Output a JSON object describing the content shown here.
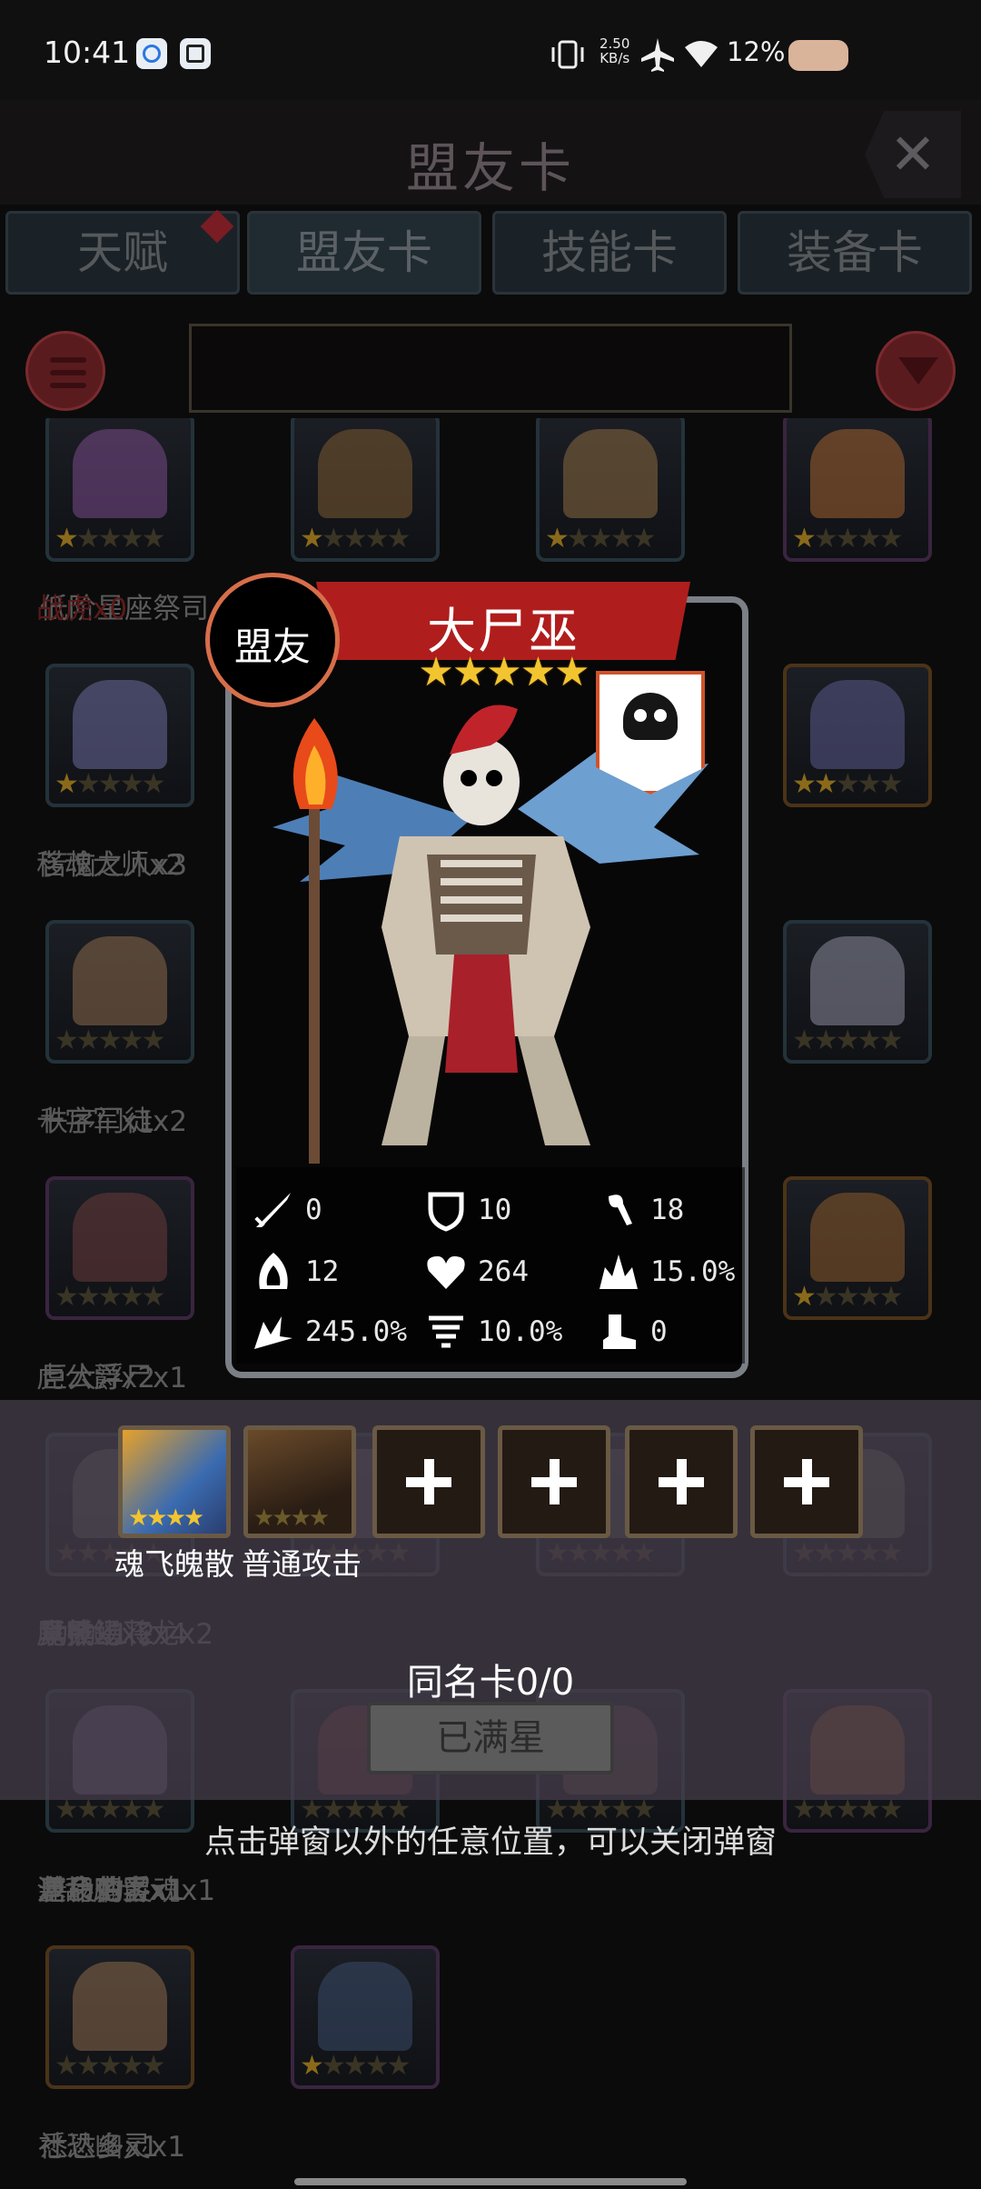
{
  "status_bar": {
    "time": "10:41",
    "net_speed_value": "2.50",
    "net_speed_unit": "KB/s",
    "battery": "12%"
  },
  "header": {
    "title": "盟友卡",
    "close": "✕"
  },
  "tabs": [
    {
      "label": "天赋",
      "has_dot": true
    },
    {
      "label": "盟友卡",
      "active": true
    },
    {
      "label": "技能卡"
    },
    {
      "label": "装备卡"
    }
  ],
  "grid": [
    {
      "name": "低阶星座祭司",
      "stars": 1
    },
    {
      "name": "",
      "stars": 1
    },
    {
      "name": "",
      "stars": 1
    },
    {
      "name": "战虎x0",
      "stars": 1
    },
    {
      "name": "苦恼之人x3",
      "stars": 1
    },
    {
      "name": "移魂大师x2",
      "stars": 2
    },
    {
      "name": "秩序门徒x2",
      "stars": 0
    },
    {
      "name": "十字军x1",
      "stars": 0
    },
    {
      "name": "巨大浮尸x1",
      "stars": 0
    },
    {
      "name": "虎公爵x2",
      "stars": 1
    },
    {
      "name": "功勋上将x4",
      "stars": 0
    },
    {
      "name": "竞技场飞龙x2",
      "stars": 0
    },
    {
      "name": "黑熊x1",
      "stars": 0
    },
    {
      "name": "厚甲鳄x2",
      "stars": 0
    },
    {
      "name": "善良的灵魂x1",
      "stars": 0
    },
    {
      "name": "逆命刺客x1",
      "stars": 0
    },
    {
      "name": "墓场伯爵x1",
      "stars": 0
    },
    {
      "name": "混乱魔士x1",
      "stars": 0
    },
    {
      "name": "悉达多x1",
      "stars": 0
    },
    {
      "name": "社恐幽灵x1",
      "stars": 1
    }
  ],
  "detail": {
    "badge": "盟友",
    "name": "大尸巫",
    "stars": "★★★★★",
    "stats": [
      {
        "icon": "sword-icon",
        "value": "0"
      },
      {
        "icon": "shield-icon",
        "value": "10"
      },
      {
        "icon": "speed-icon",
        "value": "18"
      },
      {
        "icon": "hood-icon",
        "value": "12"
      },
      {
        "icon": "heart-icon",
        "value": "264"
      },
      {
        "icon": "burst-icon",
        "value": "15.0%"
      },
      {
        "icon": "crit-icon",
        "value": "245.0%"
      },
      {
        "icon": "whirl-icon",
        "value": "10.0%"
      },
      {
        "icon": "boot-icon",
        "value": "0"
      }
    ],
    "skills": [
      {
        "label": "魂飞魄散",
        "stars": "★★★★"
      },
      {
        "label": "普通攻击",
        "stars": "★★★★"
      }
    ],
    "duplicate": "同名卡0/0",
    "max_star_button": "已满星"
  },
  "hint": "点击弹窗以外的任意位置，可以关闭弹窗",
  "colors": {
    "banner": "#b01d1d",
    "gold_star": "#f2c530",
    "badge_ring": "#d86e4a"
  }
}
